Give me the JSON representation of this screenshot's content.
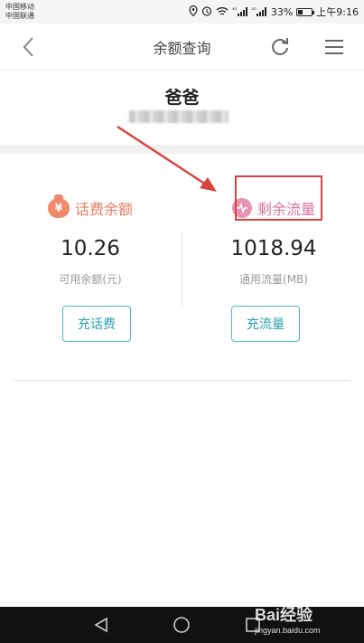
{
  "status_bar": {
    "carrier_1": "中国移动",
    "carrier_2": "中国联通",
    "signal_1": "⁴ᴳ",
    "signal_2": "²ᴳ",
    "battery": "33%",
    "battery_level": 0.33,
    "time": "上午9:16",
    "icons": [
      "location-icon",
      "alarm-icon",
      "wifi-icon",
      "signal-icon",
      "signal-icon",
      "battery-icon"
    ]
  },
  "header": {
    "title": "余额查询",
    "back_icon": "chevron-left-icon",
    "refresh_icon": "refresh-icon",
    "menu_icon": "menu-icon"
  },
  "user": {
    "name": "爸爸"
  },
  "balances": {
    "call": {
      "label": "话费余额",
      "amount": "10.26",
      "sublabel": "可用余额(元)",
      "button": "充话费",
      "icon": "money-bag-icon",
      "color": "#e57c62"
    },
    "data": {
      "label": "剩余流量",
      "amount": "1018.94",
      "sublabel": "通用流量(MB)",
      "button": "充流量",
      "icon": "data-icon",
      "color": "#d773a2"
    }
  },
  "annotation": {
    "color": "#d9423e"
  },
  "watermark": {
    "logo": "Bai经验",
    "url": "jingyan.baidu.com"
  },
  "colors": {
    "accent": "#4cb8c8",
    "call_label": "#e57c62",
    "data_label": "#d773a2",
    "highlight": "#d9423e"
  }
}
